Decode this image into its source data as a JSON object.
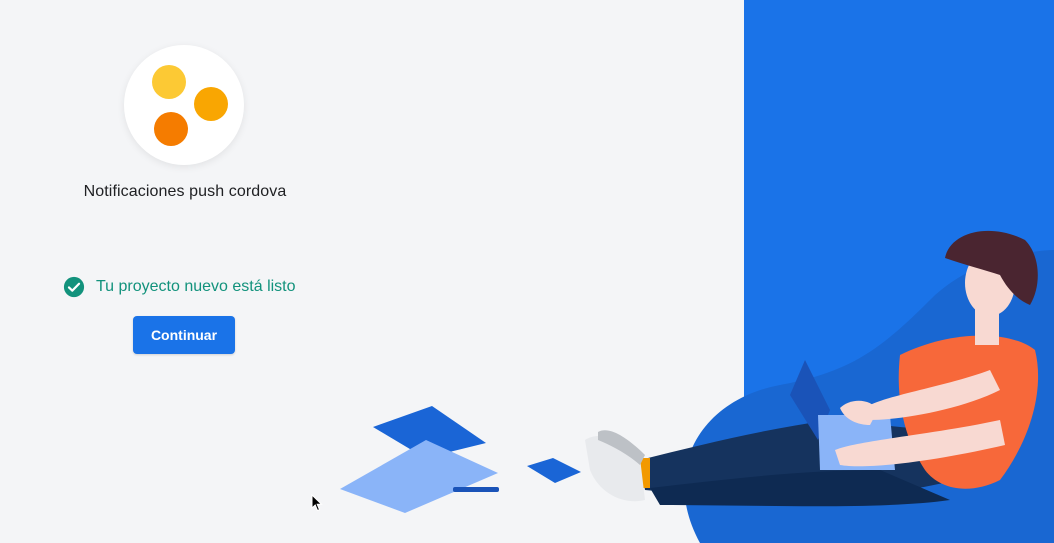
{
  "project": {
    "name": "Notificaciones push cordova",
    "logo_icon": "three-dots-logo-icon",
    "logo_colors": [
      "#fcc934",
      "#f9a602",
      "#f57c00"
    ]
  },
  "status": {
    "icon": "check-circle-icon",
    "text": "Tu proyecto nuevo está listo",
    "color": "#12927c"
  },
  "actions": {
    "continue_label": "Continuar",
    "continue_color": "#1a73e8"
  },
  "theme": {
    "background": "#f4f5f7",
    "panel_blue": "#1a73e8"
  }
}
